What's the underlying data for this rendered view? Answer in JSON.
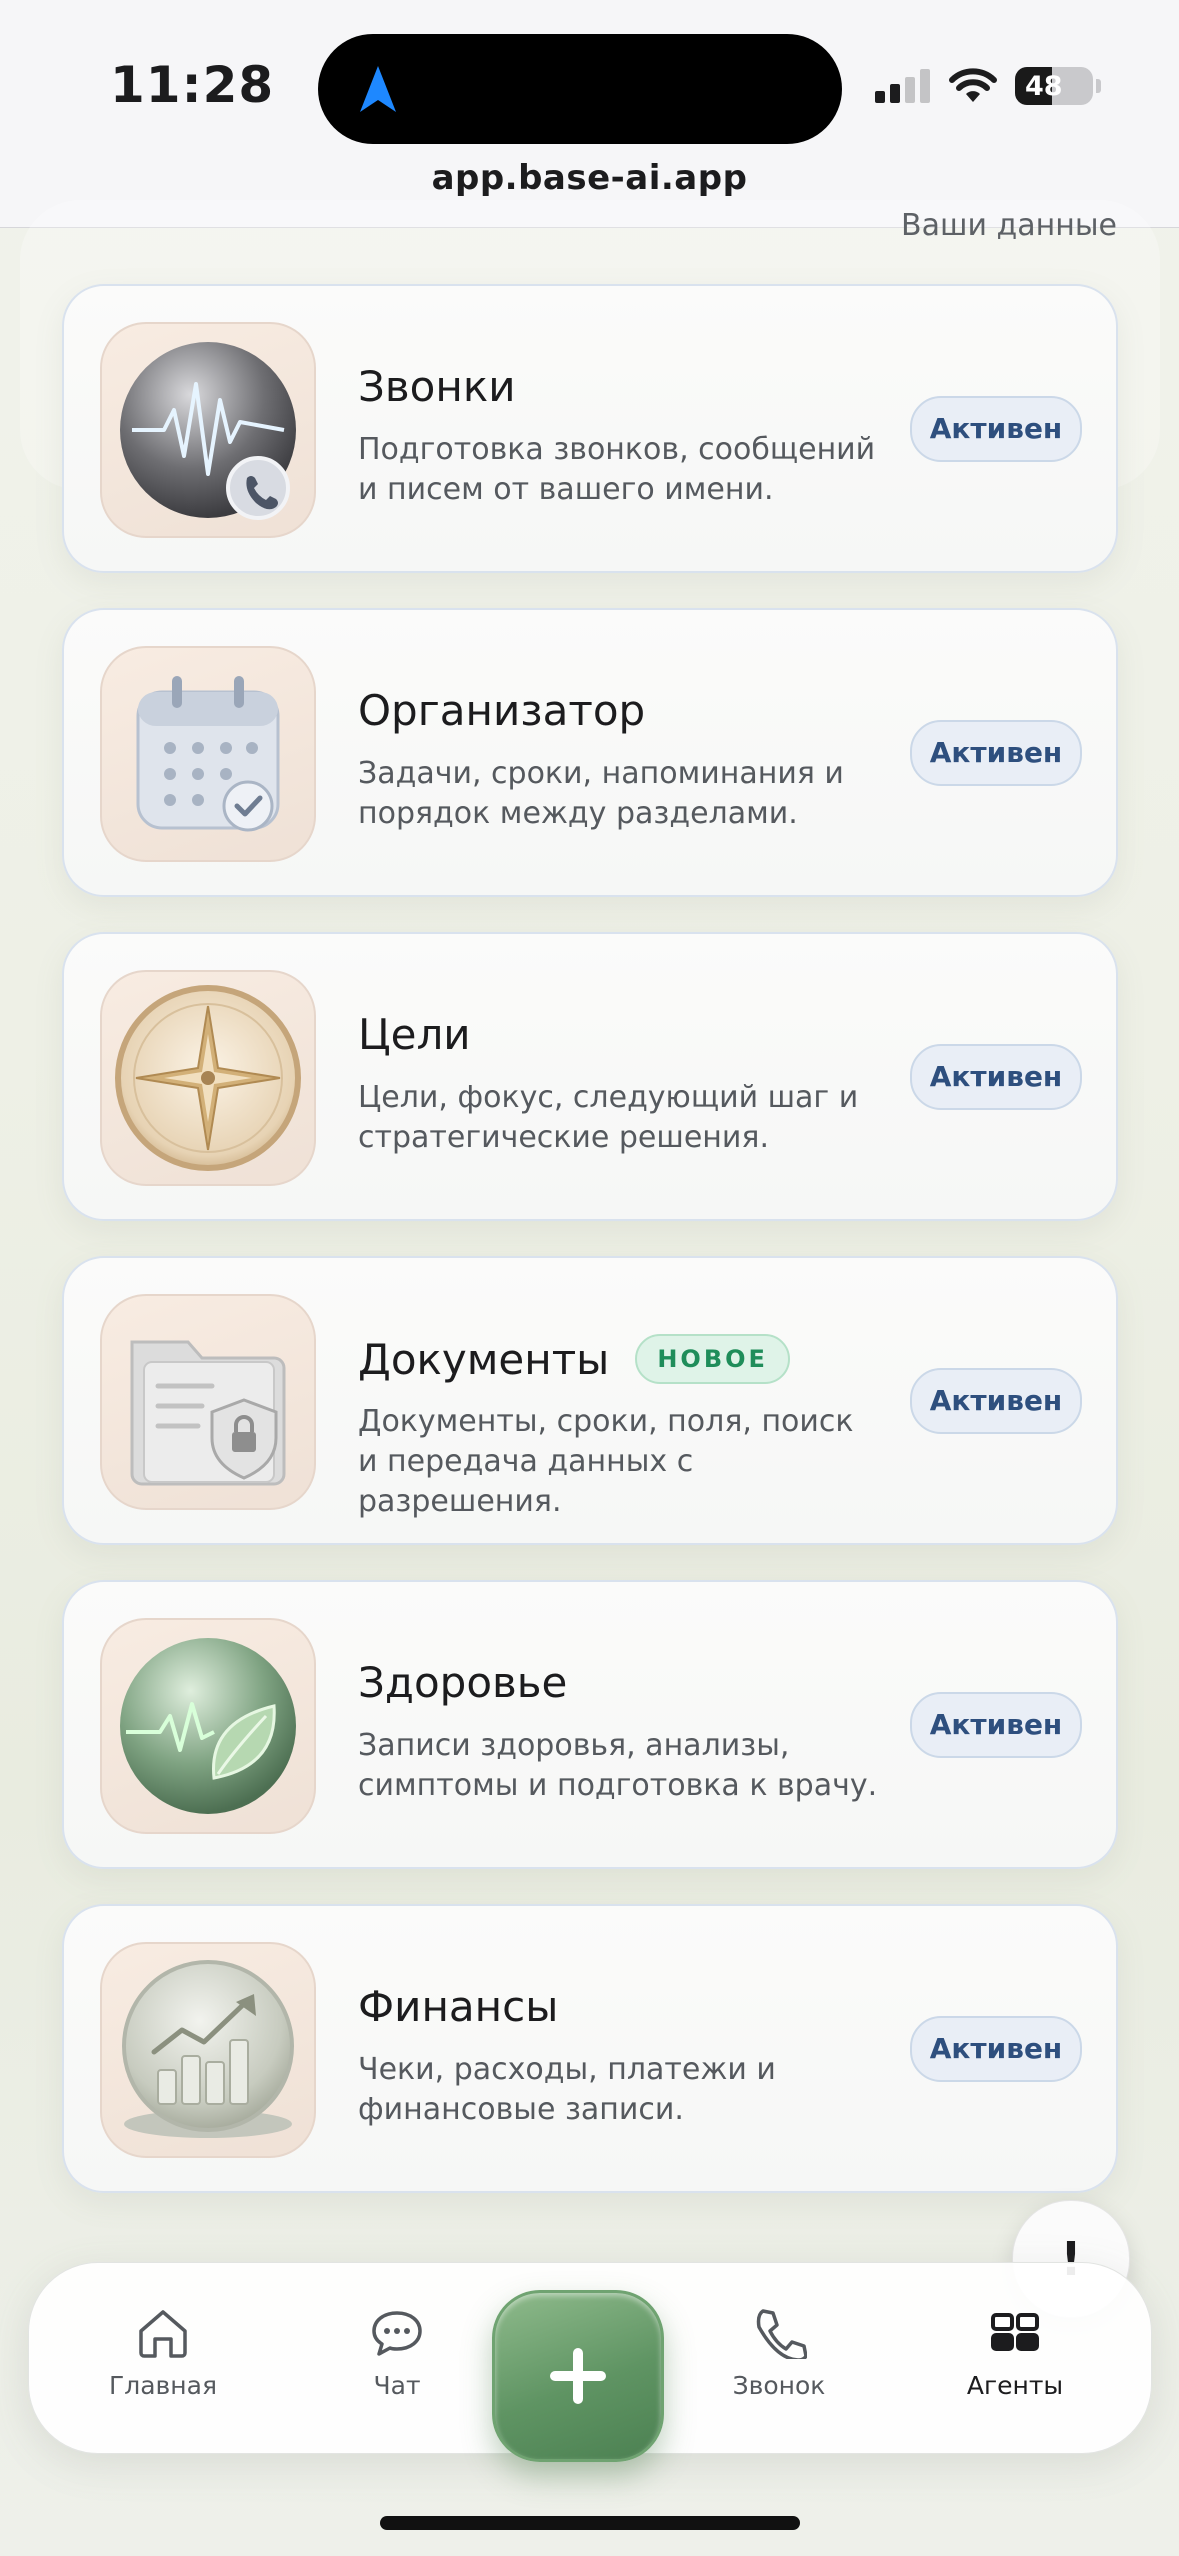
{
  "status_bar": {
    "time": "11:28",
    "battery": "48",
    "battery_level": 0.48
  },
  "browser": {
    "url": "app.base-ai.app"
  },
  "header_peek": {
    "text": "Ваши данные"
  },
  "agents": [
    {
      "title": "Звонки",
      "description": "Подготовка звонков, сообщений и писем от вашего имени.",
      "status": "Активен",
      "icon": "phone-waveform-icon"
    },
    {
      "title": "Организатор",
      "description": "Задачи, сроки, напоминания и порядок между разделами.",
      "status": "Активен",
      "icon": "calendar-check-icon"
    },
    {
      "title": "Цели",
      "description": "Цели, фокус, следующий шаг и стратегические решения.",
      "status": "Активен",
      "icon": "compass-icon"
    },
    {
      "title": "Документы",
      "badge": "НОВОЕ",
      "description": "Документы, сроки, поля, поиск и передача данных с разрешения.",
      "status": "Активен",
      "icon": "folder-lock-icon"
    },
    {
      "title": "Здоровье",
      "description": "Записи здоровья, анализы, симптомы и подготовка к врачу.",
      "status": "Активен",
      "icon": "health-leaf-icon"
    },
    {
      "title": "Финансы",
      "description": "Чеки, расходы, платежи и финансовые записи.",
      "status": "Активен",
      "icon": "finance-chart-icon"
    }
  ],
  "help_button": {
    "label": "!"
  },
  "nav": {
    "home": "Главная",
    "chat": "Чат",
    "call": "Звонок",
    "agents": "Агенты",
    "active": "agents"
  },
  "colors": {
    "accent_green": "#5f9463",
    "status_text": "#2e4f7e",
    "badge_green": "#1f8d5a"
  }
}
